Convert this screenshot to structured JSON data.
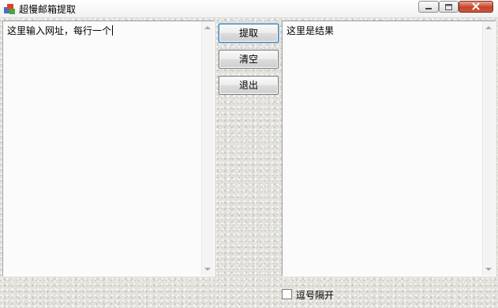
{
  "window": {
    "title": "超慢邮箱提取"
  },
  "caption_buttons": {
    "minimize_icon": "minimize-icon",
    "maximize_icon": "maximize-icon",
    "close_icon": "close-icon"
  },
  "input_pane": {
    "text": "这里输入网址，每行一个"
  },
  "result_pane": {
    "text": "这里是结果"
  },
  "buttons": {
    "extract": "提取",
    "clear": "清空",
    "exit": "退出"
  },
  "options": {
    "comma_separated_label": "逗号隔开",
    "comma_separated_checked": false
  },
  "colors": {
    "close_button": "#c5432b",
    "focus_border": "#3c7fb1"
  }
}
